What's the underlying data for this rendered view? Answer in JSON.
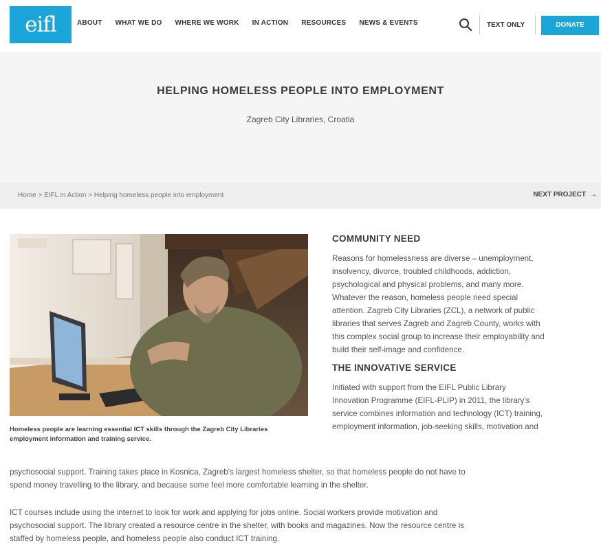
{
  "header": {
    "logo": "eifl",
    "nav": [
      "ABOUT",
      "WHAT WE DO",
      "WHERE WE WORK",
      "IN ACTION",
      "RESOURCES",
      "NEWS & EVENTS"
    ],
    "text_only": "TEXT ONLY",
    "donate": "DONATE",
    "accent_color": "#1aa6d9"
  },
  "hero": {
    "title": "HELPING HOMELESS PEOPLE INTO EMPLOYMENT",
    "subtitle": "Zagreb City Libraries, Croatia"
  },
  "breadcrumb": {
    "trail": "Home > EIFL in Action > Helping homeless people into employment",
    "next_label": "NEXT PROJECT",
    "next_arrow": "→"
  },
  "figure": {
    "caption": "Homeless people are learning essential ICT skills through the Zagreb City Libraries employment information and training service."
  },
  "content": {
    "section1_title": "COMMUNITY NEED",
    "section1_lines": [
      "Reasons for homelessness are diverse – unemployment,",
      "insolvency, divorce, troubled childhoods, addiction,",
      "psychological and physical problems, and many more.",
      "Whatever the reason, homeless people need special",
      "attention. Zagreb City Libraries (ZCL), a network of public",
      "libraries that serves Zagreb and Zagreb County, works with",
      "this complex social group to increase their employability and",
      "build their self-image and confidence."
    ],
    "section2_title": "THE INNOVATIVE SERVICE",
    "section2_lines": [
      "Initiated with support from the EIFL Public Library",
      "Innovation Programme (EIFL-PLIP) in 2011, the library's",
      "service combines information and technology (ICT) training,",
      "employment information, job-seeking skills, motivation and"
    ],
    "section2_full_lines": [
      "psychosocial support. Training takes place in Kosnica, Zagreb's largest homeless shelter, so that homeless people do not have to",
      "spend money travelling to the library, and because some feel more comfortable learning in the shelter."
    ],
    "para3_lines": [
      "ICT courses include using the internet to look for work and applying for jobs online. Social workers provide motivation and",
      "psychosocial support. The library created a resource centre in the shelter, with books and magazines. Now the resource centre is",
      "staffed by homeless people, and homeless people also conduct ICT training."
    ]
  }
}
